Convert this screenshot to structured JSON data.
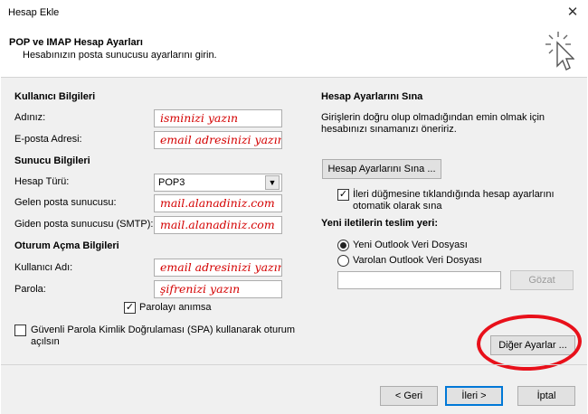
{
  "window": {
    "title": "Hesap Ekle",
    "close_glyph": "✕"
  },
  "header": {
    "title": "POP ve IMAP Hesap Ayarları",
    "subtitle": "Hesabınızın posta sunucusu ayarlarını girin."
  },
  "user_info": {
    "section": "Kullanıcı Bilgileri",
    "name_label": "Adınız:",
    "name_value": "isminizi yazın",
    "email_label": "E-posta Adresi:",
    "email_value": "email adresinizi yazın"
  },
  "server_info": {
    "section": "Sunucu Bilgileri",
    "type_label": "Hesap Türü:",
    "type_value": "POP3",
    "incoming_label": "Gelen posta sunucusu:",
    "incoming_value": "mail.alanadiniz.com",
    "outgoing_label": "Giden posta sunucusu (SMTP):",
    "outgoing_value": "mail.alanadiniz.com"
  },
  "logon_info": {
    "section": "Oturum Açma Bilgileri",
    "username_label": "Kullanıcı Adı:",
    "username_value": "email adresinizi yazın",
    "password_label": "Parola:",
    "password_value": "şifrenizi yazın",
    "remember_label": "Parolayı anımsa",
    "remember_checked": true,
    "spa_label_line1": "Güvenli Parola Kimlik Doğrulaması (SPA) kullanarak oturum",
    "spa_label_line2": "açılsın",
    "spa_checked": false
  },
  "test_settings": {
    "section": "Hesap Ayarlarını Sına",
    "desc_line1": "Girişlerin doğru olup olmadığından emin olmak için",
    "desc_line2": "hesabınızı sınamanızı öneririz.",
    "test_button": "Hesap Ayarlarını Sına ...",
    "auto_test_line1": "İleri düğmesine tıklandığında hesap ayarlarını",
    "auto_test_line2": "otomatik olarak sına",
    "auto_test_checked": true
  },
  "delivery": {
    "section": "Yeni iletilerin teslim yeri:",
    "option_new": "Yeni Outlook Veri Dosyası",
    "option_existing": "Varolan Outlook Veri Dosyası",
    "selected": "new",
    "browse_button": "Gözat"
  },
  "more_settings_button": "Diğer Ayarlar ...",
  "footer": {
    "back": "< Geri",
    "next": "İleri >",
    "cancel": "İptal"
  },
  "colors": {
    "annotation_red": "#d40000",
    "highlight_ring": "#e8101a",
    "focus_blue": "#0078d7"
  }
}
